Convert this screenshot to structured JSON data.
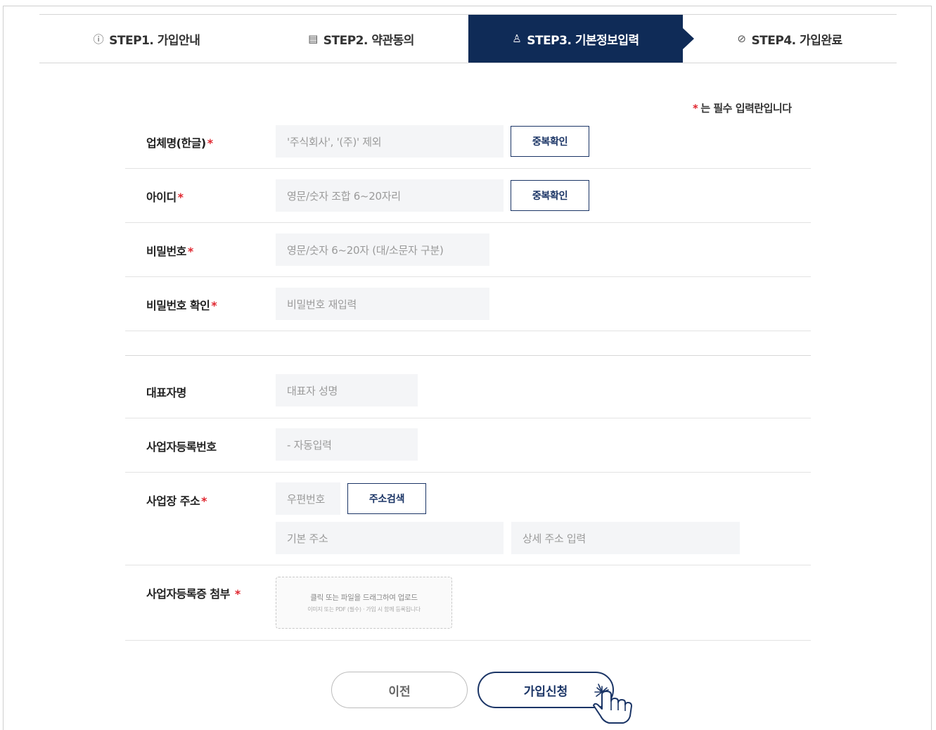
{
  "steps": [
    {
      "icon": "ⓘ",
      "label": "STEP1. 가입안내"
    },
    {
      "icon": "▤",
      "label": "STEP2. 약관동의"
    },
    {
      "icon": "♙",
      "label": "STEP3. 기본정보입력"
    },
    {
      "icon": "⊘",
      "label": "STEP4. 가입완료"
    }
  ],
  "required_note": {
    "star": "*",
    "text": "는 필수 입력란입니다"
  },
  "form": {
    "company_name": {
      "label": "업체명(한글)",
      "star": "*",
      "placeholder": "'주식회사', '(주)' 제외",
      "button": "중복확인"
    },
    "user_id": {
      "label": "아이디",
      "star": "*",
      "placeholder": "영문/숫자 조합 6~20자리",
      "button": "중복확인"
    },
    "password": {
      "label": "비밀번호",
      "star": "*",
      "placeholder": "영문/숫자 6~20자 (대/소문자 구분)"
    },
    "password_confirm": {
      "label": "비밀번호 확인",
      "star": "*",
      "placeholder": "비밀번호 재입력"
    },
    "representative": {
      "label": "대표자명",
      "placeholder": "대표자 성명"
    },
    "business_number": {
      "label": "사업자등록번호",
      "placeholder": "- 자동입력"
    },
    "address": {
      "label": "사업장 주소",
      "star": "*",
      "zip_placeholder": "우편번호",
      "search_button": "주소검색",
      "basic_placeholder": "기본 주소",
      "detail_placeholder": "상세 주소 입력"
    },
    "attachment": {
      "label": "사업자등록증 첨부",
      "star": "*",
      "line1": "클릭 또는 파일을 드래그하여 업로드",
      "line2": "이미지 또는 PDF (필수) · 가입 시 함께 등록됩니다"
    }
  },
  "buttons": {
    "prev": "이전",
    "submit": "가입신청"
  },
  "colors": {
    "navy": "#0f2b57",
    "required": "#e0262f"
  }
}
